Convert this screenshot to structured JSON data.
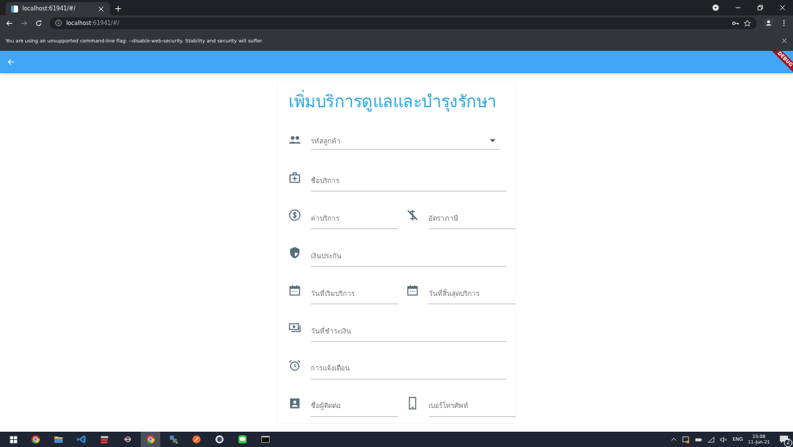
{
  "browser": {
    "tabs": [
      {
        "title": "localhost:61941/#/",
        "selected": true
      }
    ],
    "address": "**localhost**:61941/#/",
    "infobar": "You are using an unsupported command-line flag: --disable-web-security. Stability and security will suffer."
  },
  "app": {
    "debug_banner": "DEBUG",
    "title": "เพิ่มบริการดูแลและบำรุงรักษา",
    "rows": [
      {
        "fields": [
          {
            "kind": "dropdown",
            "placeholder": "รหัสลูกค้า"
          }
        ]
      },
      {
        "fields": [
          {
            "kind": "text",
            "placeholder": "ชื่อบริการ"
          }
        ]
      },
      {
        "fields": [
          {
            "kind": "text",
            "placeholder": "ค่าบริการ"
          },
          {
            "kind": "text",
            "placeholder": "อัตราภาษี"
          }
        ]
      },
      {
        "fields": [
          {
            "kind": "text",
            "placeholder": "เงินประกัน"
          }
        ]
      },
      {
        "fields": [
          {
            "kind": "text",
            "placeholder": "วันที่เริ่มบริการ"
          },
          {
            "kind": "text",
            "placeholder": "วันที่สิ้นสุดบริการ"
          }
        ]
      },
      {
        "fields": [
          {
            "kind": "text",
            "placeholder": "วันที่ชำระเงิน"
          }
        ]
      },
      {
        "fields": [
          {
            "kind": "text",
            "placeholder": "การแจ้งเตือน"
          }
        ]
      },
      {
        "fields": [
          {
            "kind": "text",
            "placeholder": "ชื่อผู้ติดต่อ"
          },
          {
            "kind": "text",
            "placeholder": "เบอร์โทรศัพท์"
          }
        ]
      }
    ]
  },
  "taskbar": {
    "apps": [
      {
        "selected": false
      },
      {
        "selected": false
      },
      {
        "selected": false
      },
      {
        "selected": false
      },
      {
        "selected": false
      },
      {
        "selected": true
      },
      {
        "selected": false
      },
      {
        "selected": false
      },
      {
        "selected": false
      },
      {
        "selected": false
      },
      {
        "selected": false
      }
    ],
    "language": "ENG",
    "time": "15:08",
    "date": "11-Jun-21",
    "notifications": "2"
  }
}
